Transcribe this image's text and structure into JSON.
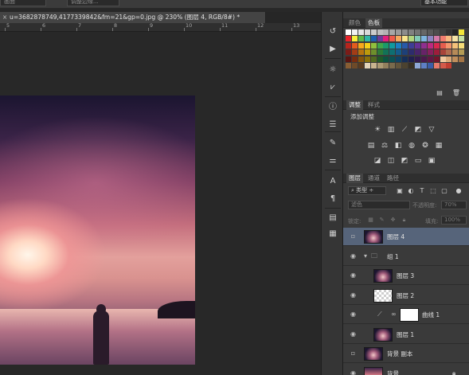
{
  "options_bar": {
    "left_field": "画面",
    "mid_field": "调整边缘...",
    "workspace": "基本功能"
  },
  "document": {
    "tab_title": "u=3682878749,4177339842&fm=21&gp=0.jpg @ 230% (图层 4, RGB/8#) *",
    "close_glyph": "×"
  },
  "ruler": {
    "ticks": [
      "5",
      "6",
      "7",
      "8",
      "9",
      "10",
      "11",
      "12",
      "13"
    ]
  },
  "toolbar": {
    "icons": [
      "history-icon",
      "play-icon",
      "brightness-icon",
      "histogram-icon",
      "info-icon",
      "properties-icon",
      "brush-icon",
      "brush-settings-icon",
      "character-icon",
      "paragraph-icon",
      "notes-icon",
      "layers-comp-icon"
    ]
  },
  "swatches_panel": {
    "tabs": [
      "颜色",
      "色板"
    ],
    "active_tab": "色板",
    "colors": [
      "#ffffff",
      "#f2f2f2",
      "#e6e6e6",
      "#d9d9d9",
      "#cccccc",
      "#bfbfbf",
      "#b3b3b3",
      "#a6a6a6",
      "#999999",
      "#8c8c8c",
      "#808080",
      "#737373",
      "#666666",
      "#595959",
      "#4d4d4d",
      "#404040",
      "#333333",
      "#262626",
      "#f3e63a",
      "#e8232a",
      "#f7ee3a",
      "#5fb848",
      "#2fb5a6",
      "#1d5fae",
      "#6e3c98",
      "#e3207b",
      "#ee5a4a",
      "#f5a85e",
      "#f9e48d",
      "#b0d57f",
      "#82cbb6",
      "#7eb4df",
      "#8e86c2",
      "#d57aa9",
      "#f27d6f",
      "#f7b980",
      "#f6e3a6",
      "#c4e0a2",
      "#b6241c",
      "#e45b1e",
      "#f7a81b",
      "#f3d019",
      "#90c13d",
      "#3fa64a",
      "#1a9a6a",
      "#109a9e",
      "#1c7fc1",
      "#2759a8",
      "#3e3d96",
      "#653195",
      "#8f2f8f",
      "#bc2a80",
      "#d9284f",
      "#e45c4d",
      "#f1956c",
      "#f4c17a",
      "#f6dd78",
      "#7c1c18",
      "#a33c16",
      "#b7740f",
      "#bd9a0c",
      "#6e8f2c",
      "#2d7b37",
      "#127257",
      "#0f6f72",
      "#145c8c",
      "#1d4079",
      "#2d2c6d",
      "#48246b",
      "#672368",
      "#87205e",
      "#9e1d3b",
      "#a8453a",
      "#b06d4f",
      "#b68a58",
      "#b59c55",
      "#5a1512",
      "#772c10",
      "#86550b",
      "#8a7009",
      "#516a20",
      "#205a28",
      "#0c5340",
      "#0b5154",
      "#0f4366",
      "#152e58",
      "#20204f",
      "#341a4e",
      "#4a194c",
      "#621745",
      "#73152b",
      "#f0c99f",
      "#d8a978",
      "#c08e5c",
      "#a47444",
      "#885d33",
      "#6e4a28",
      "#5a3b1f",
      "#e3d3b8",
      "#c9b48f",
      "#ad9a74",
      "#93805d",
      "#7a6a4c",
      "#62553c",
      "#4c422f",
      "#383023",
      "#8ea7d6",
      "#5e7fc4",
      "#3b5da8",
      "#e87a6b",
      "#d45a4a",
      "#c23f32"
    ]
  },
  "adjustments_panel": {
    "tabs": [
      "调整",
      "样式"
    ],
    "active_tab": "调整",
    "title": "添加调整",
    "row1": [
      "brightness-contrast-icon",
      "levels-icon",
      "curves-icon",
      "exposure-icon",
      "vibrance-icon"
    ],
    "row2": [
      "hue-saturation-icon",
      "color-balance-icon",
      "black-white-icon",
      "photo-filter-icon",
      "channel-mixer-icon",
      "color-lookup-icon"
    ],
    "row3": [
      "invert-icon",
      "posterize-icon",
      "threshold-icon",
      "gradient-map-icon",
      "selective-color-icon"
    ]
  },
  "layers_panel": {
    "tabs": [
      "图层",
      "通道",
      "路径"
    ],
    "active_tab": "图层",
    "filter_kind": "类型",
    "blend_mode": "滤色",
    "opacity_label": "不透明度:",
    "opacity_value": "70%",
    "lock_label": "锁定:",
    "fill_label": "填充:",
    "fill_value": "100%",
    "layers": [
      {
        "name": "图层 4",
        "visible": false,
        "selected": true,
        "indent": 0,
        "kind": "pixel"
      },
      {
        "name": "组 1",
        "visible": true,
        "selected": false,
        "indent": 0,
        "kind": "group"
      },
      {
        "name": "图层 3",
        "visible": true,
        "selected": false,
        "indent": 1,
        "kind": "pixel"
      },
      {
        "name": "图层 2",
        "visible": true,
        "selected": false,
        "indent": 1,
        "kind": "pixel-transparent"
      },
      {
        "name": "曲线 1",
        "visible": true,
        "selected": false,
        "indent": 1,
        "kind": "adjustment"
      },
      {
        "name": "图层 1",
        "visible": true,
        "selected": false,
        "indent": 1,
        "kind": "pixel"
      },
      {
        "name": "背景 副本",
        "visible": false,
        "selected": false,
        "indent": 0,
        "kind": "pixel"
      },
      {
        "name": "背景",
        "visible": true,
        "selected": false,
        "indent": 0,
        "kind": "background",
        "locked": true
      }
    ]
  }
}
